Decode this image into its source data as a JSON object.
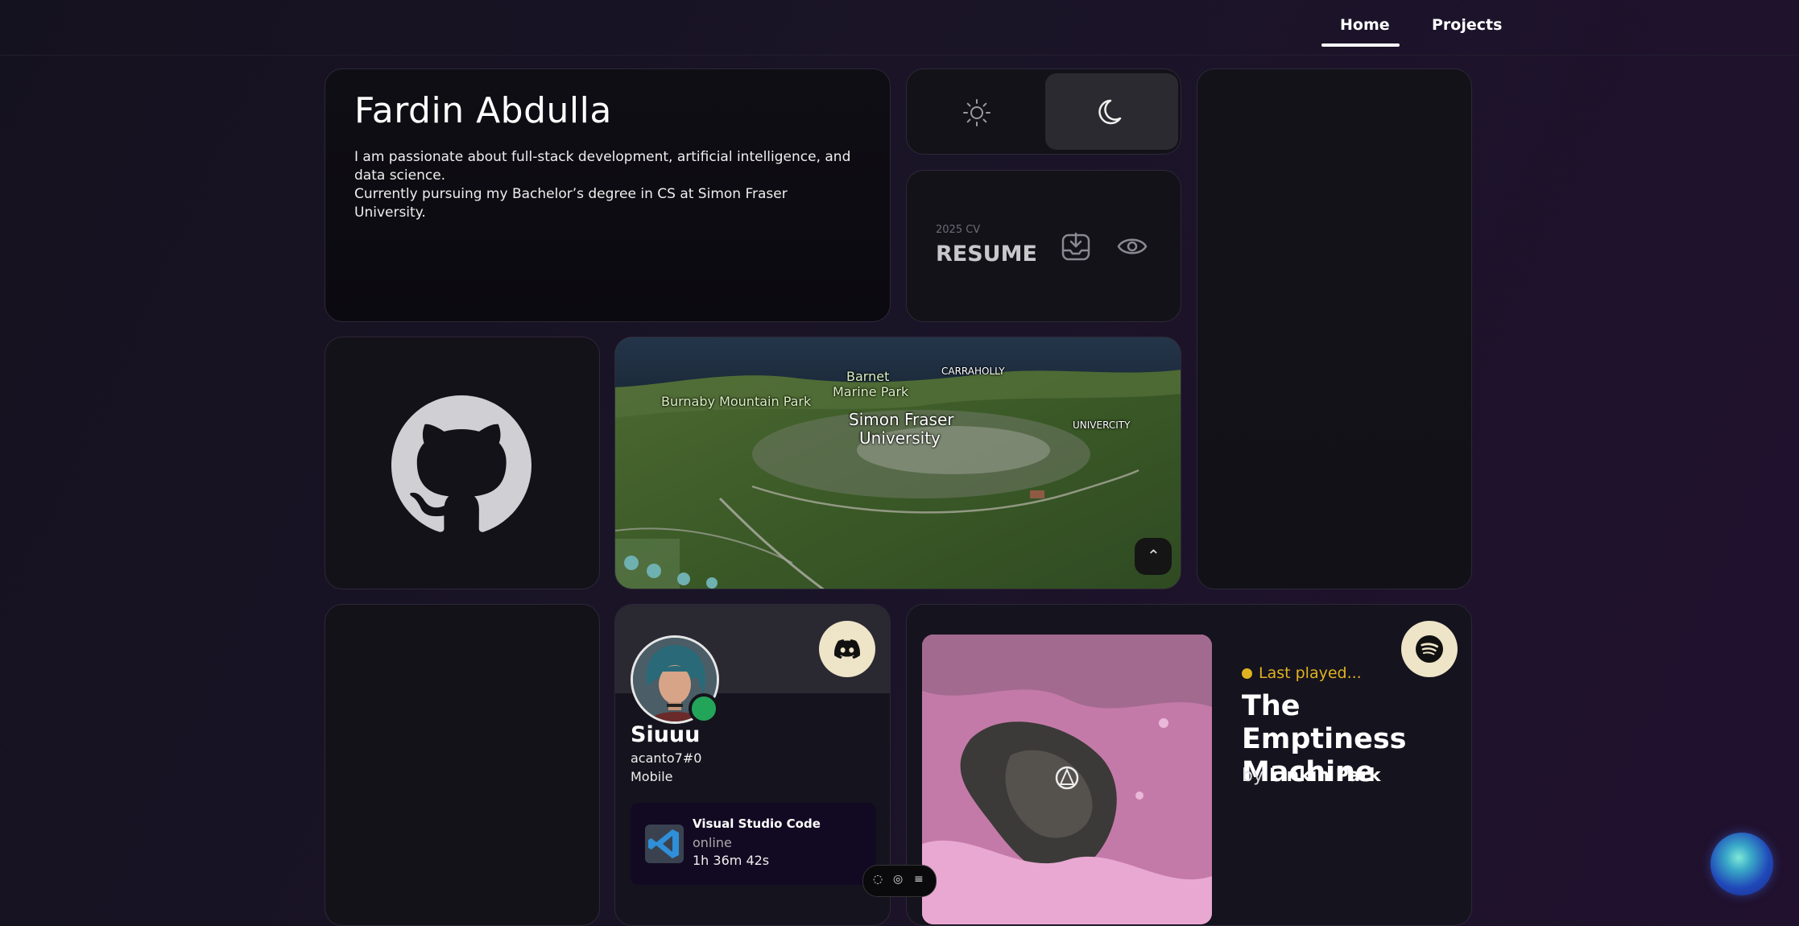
{
  "nav": {
    "home": "Home",
    "projects": "Projects"
  },
  "intro": {
    "name": "Fardin Abdulla",
    "line1": "I am passionate about full-stack development, artificial intelligence, and data science.",
    "line2": "Currently pursuing my Bachelor’s degree in CS at Simon Fraser University."
  },
  "theme": {
    "light_icon": "sun-icon",
    "dark_icon": "moon-icon",
    "selected": "dark"
  },
  "resume": {
    "subtitle": "2025 CV",
    "title": "RESUME"
  },
  "map": {
    "labels": {
      "burnaby": "Burnaby Mountain Park",
      "barnet": "Barnet",
      "barnet2": "Marine Park",
      "carraholly": "CARRAHOLLY",
      "sfu1": "Simon Fraser",
      "sfu2": "University",
      "univercity": "UNIVERCITY"
    }
  },
  "discord": {
    "username": "Siuuu",
    "tag": "acanto7#0",
    "device": "Mobile",
    "activity": {
      "name": "Visual Studio Code",
      "status": "online",
      "elapsed": "1h 36m 42s"
    }
  },
  "spotify": {
    "label": "Last played...",
    "song": "The Emptiness Machine",
    "by": "by",
    "artist": "Linkin Park"
  },
  "colors": {
    "accent_yellow": "#e0b321",
    "discord_online": "#23a559",
    "button_cream": "#eee4c8"
  }
}
